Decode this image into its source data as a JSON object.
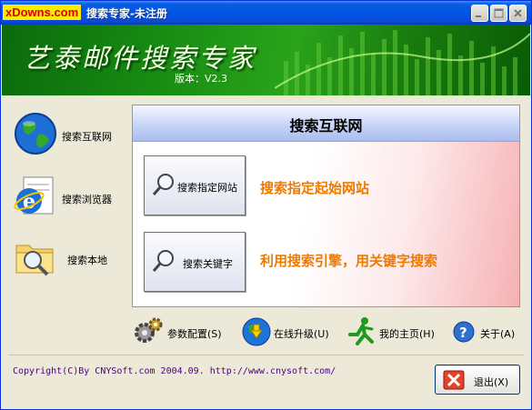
{
  "window": {
    "watermark": "xDowns.com",
    "title": "搜索专家-未注册",
    "controls": [
      "minimize",
      "maximize",
      "close"
    ]
  },
  "header": {
    "title": "艺泰邮件搜索专家",
    "version": "版本：V2.3"
  },
  "sidebar": {
    "items": [
      {
        "label": "搜索互联网",
        "icon": "globe-icon"
      },
      {
        "label": "搜索浏览器",
        "icon": "ie-browser-icon"
      },
      {
        "label": "搜索本地",
        "icon": "folder-search-icon"
      }
    ]
  },
  "panel": {
    "title": "搜索互联网",
    "actions": [
      {
        "button": "搜索指定网站",
        "description": "搜索指定起始网站"
      },
      {
        "button": "搜索关键字",
        "description": "利用搜索引擎，用关键字搜索"
      }
    ]
  },
  "toolbar": {
    "items": [
      {
        "label": "参数配置(S)",
        "icon": "gear-icon"
      },
      {
        "label": "在线升级(U)",
        "icon": "update-globe-icon"
      },
      {
        "label": "我的主页(H)",
        "icon": "running-man-icon"
      },
      {
        "label": "关于(A)",
        "icon": "help-icon"
      }
    ]
  },
  "footer": {
    "copyright": "Copyright(C)By CNYSoft.com 2004.09. http://www.cnysoft.com/",
    "exit_label": "退出(X)"
  },
  "colors": {
    "accent_orange": "#ee7a00",
    "banner_green": "#178c12",
    "titlebar_blue": "#0054e3",
    "copyright_purple": "#4b0082"
  }
}
